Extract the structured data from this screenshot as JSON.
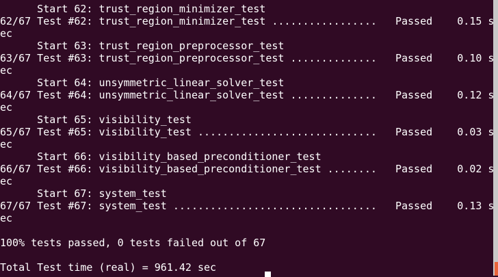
{
  "terminal": {
    "lines": [
      "      Start 62: trust_region_minimizer_test",
      "62/67 Test #62: trust_region_minimizer_test .................   Passed    0.15 s",
      "ec",
      "      Start 63: trust_region_preprocessor_test",
      "63/67 Test #63: trust_region_preprocessor_test ..............   Passed    0.10 s",
      "ec",
      "      Start 64: unsymmetric_linear_solver_test",
      "64/67 Test #64: unsymmetric_linear_solver_test ..............   Passed    0.12 s",
      "ec",
      "      Start 65: visibility_test",
      "65/67 Test #65: visibility_test .............................   Passed    0.03 s",
      "ec",
      "      Start 66: visibility_based_preconditioner_test",
      "66/67 Test #66: visibility_based_preconditioner_test ........   Passed    0.02 s",
      "ec",
      "      Start 67: system_test",
      "67/67 Test #67: system_test .................................   Passed    0.13 s",
      "ec",
      "",
      "100% tests passed, 0 tests failed out of 67",
      "",
      "Total Test time (real) = 961.42 sec"
    ]
  }
}
